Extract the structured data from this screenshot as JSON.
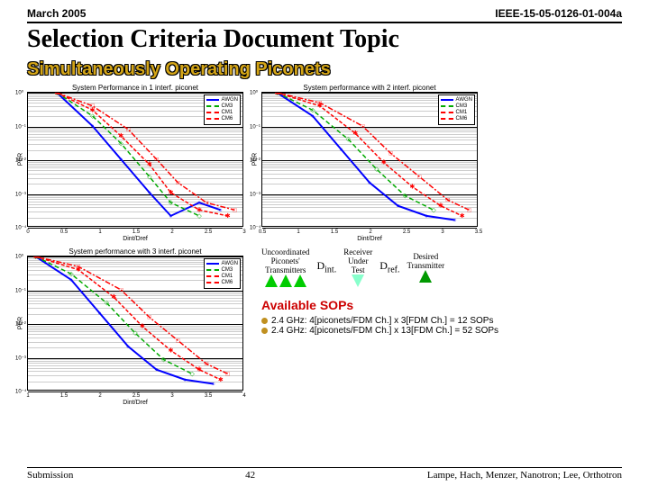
{
  "header": {
    "date": "March 2005",
    "doc_id": "IEEE-15-05-0126-01-004a"
  },
  "titles": {
    "main": "Selection Criteria Document Topic",
    "sub": "Simultaneously Operating Piconets"
  },
  "legend": {
    "items": [
      "AWGN",
      "CM3",
      "CM1",
      "CM6"
    ]
  },
  "axes": {
    "ylabel": "PER",
    "xlabel": "Dint/Dref",
    "yticks": [
      "10⁰",
      "10⁻¹",
      "10⁻²",
      "10⁻³",
      "10⁻⁴"
    ]
  },
  "chart1": {
    "title": "System Performance in 1 interf. piconet",
    "xticks": [
      "0",
      "0.5",
      "1",
      "1.5",
      "2",
      "2.5",
      "3"
    ],
    "xrange": [
      0,
      3
    ]
  },
  "chart2": {
    "title": "System performance with 2 interf. piconet",
    "xticks": [
      "0.5",
      "1",
      "1.5",
      "2",
      "2.5",
      "3",
      "3.5"
    ],
    "xrange": [
      0.5,
      3.5
    ]
  },
  "chart3": {
    "title": "System performance with 3 interf. piconet",
    "xticks": [
      "1",
      "1.5",
      "2",
      "2.5",
      "3",
      "3.5",
      "4"
    ],
    "xrange": [
      1,
      4
    ]
  },
  "diagram": {
    "uncoord": "Uncoordinated\nPiconets'\nTransmitters",
    "receiver": "Receiver\nUnder\nTest",
    "desired": "Desired\nTransmitter",
    "dint": "Dint.",
    "dref": "Dref."
  },
  "sop": {
    "title": "Available SOPs",
    "line1": "2.4 GHz: 4[piconets/FDM Ch.] x 3[FDM Ch.] = 12 SOPs",
    "line2": "2.4 GHz: 4[piconets/FDM Ch.] x 13[FDM Ch.] = 52 SOPs"
  },
  "footer": {
    "left": "Submission",
    "page": "42",
    "right": "Lampe, Hach, Menzer, Nanotron; Lee, Orthotron"
  },
  "chart_data": [
    {
      "type": "line",
      "title": "System Performance in 1 interf. piconet",
      "xlabel": "Dint/Dref",
      "ylabel": "PER",
      "ylim": [
        0.0001,
        1
      ],
      "xlim": [
        0,
        3
      ],
      "yscale": "log",
      "series": [
        {
          "name": "AWGN",
          "x": [
            0.4,
            0.9,
            1.3,
            1.7,
            2.0,
            2.4,
            2.7
          ],
          "y": [
            1,
            0.1,
            0.01,
            0.001,
            0.0002,
            0.0005,
            0.0003
          ]
        },
        {
          "name": "CM3",
          "x": [
            0.4,
            0.9,
            1.3,
            1.7,
            2.0,
            2.4
          ],
          "y": [
            1,
            0.2,
            0.03,
            0.003,
            0.0005,
            0.0002
          ]
        },
        {
          "name": "CM1",
          "x": [
            0.4,
            0.9,
            1.3,
            1.7,
            2.0,
            2.4,
            2.8
          ],
          "y": [
            1,
            0.3,
            0.05,
            0.007,
            0.001,
            0.0003,
            0.0002
          ]
        },
        {
          "name": "CM6",
          "x": [
            0.4,
            0.9,
            1.4,
            1.8,
            2.1,
            2.5,
            2.9
          ],
          "y": [
            1,
            0.4,
            0.08,
            0.01,
            0.002,
            0.0005,
            0.0003
          ]
        }
      ]
    },
    {
      "type": "line",
      "title": "System performance with 2 interf. piconet",
      "xlabel": "Dint/Dref",
      "ylabel": "PER",
      "ylim": [
        0.0001,
        1
      ],
      "xlim": [
        0.5,
        3.5
      ],
      "yscale": "log",
      "series": [
        {
          "name": "AWGN",
          "x": [
            0.7,
            1.2,
            1.6,
            2.0,
            2.4,
            2.8,
            3.2
          ],
          "y": [
            1,
            0.2,
            0.02,
            0.002,
            0.0004,
            0.0002,
            0.00015
          ]
        },
        {
          "name": "CM3",
          "x": [
            0.7,
            1.2,
            1.7,
            2.1,
            2.5,
            2.9
          ],
          "y": [
            1,
            0.3,
            0.04,
            0.005,
            0.0008,
            0.0003
          ]
        },
        {
          "name": "CM1",
          "x": [
            0.7,
            1.3,
            1.8,
            2.2,
            2.6,
            3.0,
            3.3
          ],
          "y": [
            1,
            0.4,
            0.06,
            0.008,
            0.0015,
            0.0004,
            0.0002
          ]
        },
        {
          "name": "CM6",
          "x": [
            0.7,
            1.3,
            1.9,
            2.3,
            2.7,
            3.1,
            3.4
          ],
          "y": [
            1,
            0.5,
            0.1,
            0.015,
            0.003,
            0.0006,
            0.0003
          ]
        }
      ]
    },
    {
      "type": "line",
      "title": "System performance with 3 interf. piconet",
      "xlabel": "Dint/Dref",
      "ylabel": "PER",
      "ylim": [
        0.0001,
        1
      ],
      "xlim": [
        1,
        4
      ],
      "yscale": "log",
      "series": [
        {
          "name": "AWGN",
          "x": [
            1.1,
            1.6,
            2.0,
            2.4,
            2.8,
            3.2,
            3.6
          ],
          "y": [
            1,
            0.2,
            0.02,
            0.002,
            0.0004,
            0.0002,
            0.00015
          ]
        },
        {
          "name": "CM3",
          "x": [
            1.1,
            1.6,
            2.1,
            2.5,
            2.9,
            3.3
          ],
          "y": [
            1,
            0.3,
            0.04,
            0.005,
            0.0008,
            0.0003
          ]
        },
        {
          "name": "CM1",
          "x": [
            1.1,
            1.7,
            2.2,
            2.6,
            3.0,
            3.4,
            3.7
          ],
          "y": [
            1,
            0.4,
            0.06,
            0.008,
            0.0015,
            0.0004,
            0.0002
          ]
        },
        {
          "name": "CM6",
          "x": [
            1.1,
            1.7,
            2.3,
            2.7,
            3.1,
            3.5,
            3.8
          ],
          "y": [
            1,
            0.5,
            0.1,
            0.015,
            0.003,
            0.0006,
            0.0003
          ]
        }
      ]
    }
  ]
}
